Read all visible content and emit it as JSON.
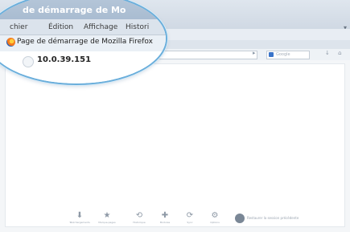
{
  "window": {
    "title": "de démarrage de Mo",
    "tab_title": "Page de démarrage de Mozilla Firefox",
    "url": "10.0.39.151"
  },
  "menubar": {
    "items": [
      {
        "label": "chier"
      },
      {
        "label": "Édition"
      },
      {
        "label": "Affichage"
      },
      {
        "label": "Histori"
      }
    ]
  },
  "navbar": {
    "search_placeholder": "Google"
  },
  "launcher": {
    "items": [
      {
        "icon": "download-icon",
        "label": "Téléchargements"
      },
      {
        "icon": "bookmark-icon",
        "label": "Marque-pages"
      },
      {
        "icon": "history-icon",
        "label": "Historique"
      },
      {
        "icon": "addons-icon",
        "label": "Modules"
      },
      {
        "icon": "sync-icon",
        "label": "Sync"
      },
      {
        "icon": "settings-icon",
        "label": "Options"
      }
    ],
    "restore_session_label": "Restaurer la session précédente"
  },
  "colors": {
    "accent": "#6aaedb",
    "titlebar": "#cfd8e3",
    "firefox_orange": "#f47a1f"
  }
}
